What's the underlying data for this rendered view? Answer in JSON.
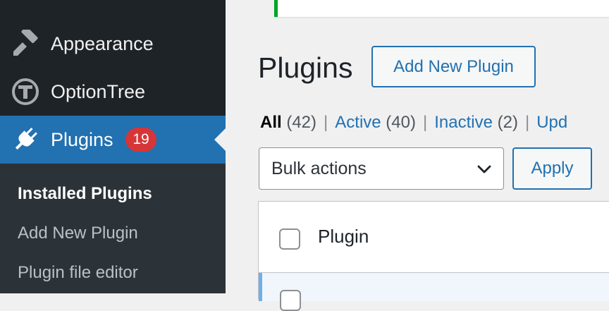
{
  "sidebar": {
    "items": [
      {
        "label": "Appearance",
        "icon": "paintbrush-icon"
      },
      {
        "label": "OptionTree",
        "icon": "optiontree-logo-icon"
      },
      {
        "label": "Plugins",
        "icon": "plug-icon",
        "badge": "19",
        "current": true
      }
    ],
    "submenu": [
      {
        "label": "Installed Plugins",
        "current": true
      },
      {
        "label": "Add New Plugin"
      },
      {
        "label": "Plugin file editor"
      }
    ]
  },
  "main": {
    "title": "Plugins",
    "add_new_label": "Add New Plugin",
    "filters": {
      "all_label": "All",
      "all_count": "(42)",
      "active_label": "Active",
      "active_count": "(40)",
      "inactive_label": "Inactive",
      "inactive_count": "(2)",
      "update_label": "Upd",
      "separator": "|"
    },
    "bulk_actions": {
      "selected": "Bulk actions"
    },
    "apply_label": "Apply",
    "table": {
      "column_plugin": "Plugin"
    }
  },
  "colors": {
    "sidebar_bg": "#1d2327",
    "accent": "#2271b1",
    "badge": "#d63638",
    "notice_border": "#00a32a"
  }
}
